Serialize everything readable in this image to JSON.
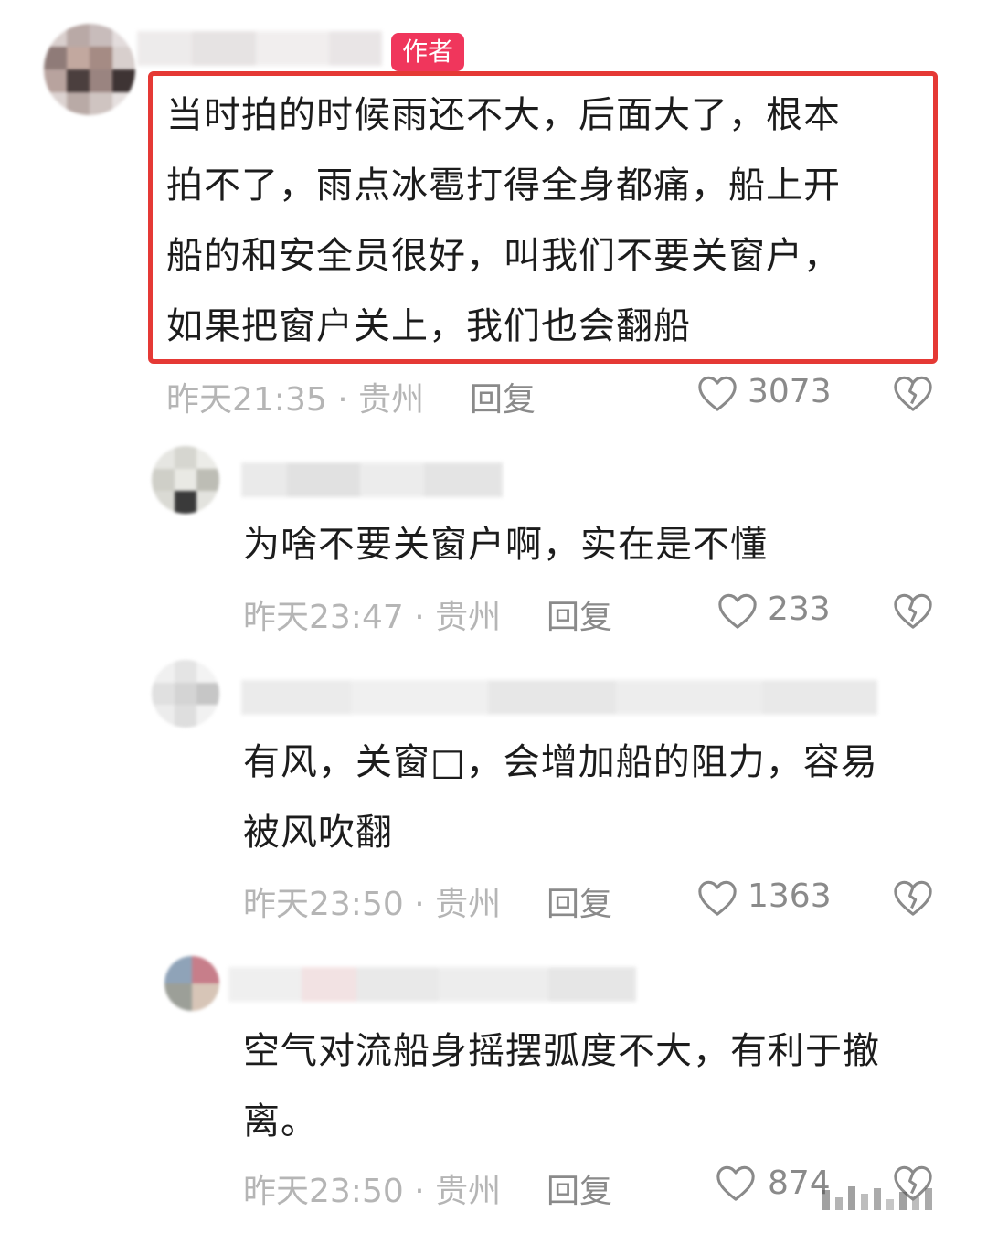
{
  "comments": [
    {
      "badge": "作者",
      "lines": [
        "当时拍的时候雨还不大，后面大了，根本",
        "拍不了，雨点冰雹打得全身都痛，船上开",
        "船的和安全员很好，叫我们不要关窗户，",
        "如果把窗户关上，我们也会翻船"
      ],
      "meta": "昨天21:35 · 贵州",
      "reply": "回复",
      "likes": "3073"
    },
    {
      "lines": [
        "为啥不要关窗户啊，实在是不懂"
      ],
      "meta": "昨天23:47 · 贵州",
      "reply": "回复",
      "likes": "233"
    },
    {
      "lines": [
        "有风，关窗□，会增加船的阻力，容易",
        "被风吹翻"
      ],
      "meta": "昨天23:50 · 贵州",
      "reply": "回复",
      "likes": "1363"
    },
    {
      "lines": [
        "空气对流船身摇摆弧度不大，有利于撤",
        "离。"
      ],
      "meta": "昨天23:50 · 贵州",
      "reply": "回复",
      "likes": "874"
    }
  ],
  "colors": {
    "badge": "#f0365c",
    "highlight_border": "#e53935"
  }
}
